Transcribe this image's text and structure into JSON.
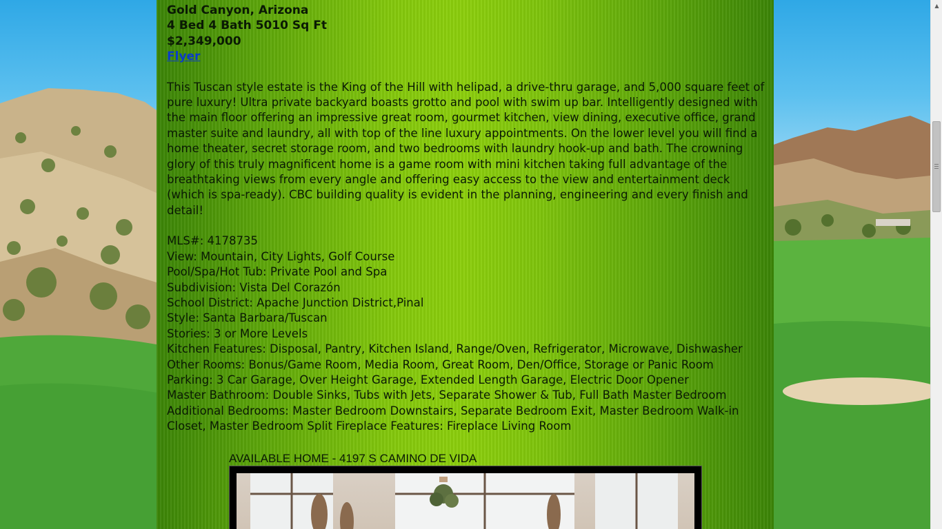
{
  "listing": {
    "location": "Gold Canyon, Arizona",
    "specs": "4 Bed 4 Bath 5010 Sq Ft",
    "price": "$2,349,000",
    "flyer_link": "Flyer",
    "description": "This Tuscan style estate is the King of the Hill with helipad, a drive-thru garage, and 5,000 square feet of pure luxury! Ultra private backyard boasts grotto and pool with swim up bar. Intelligently designed with the main floor offering an impressive great room, gourmet kitchen, view dining, executive office, grand master suite and laundry, all with top of the line luxury appointments. On the lower level you will find a home theater, secret storage room, and two bedrooms with laundry hook-up and bath. The crowning glory of this truly magnificent home is a game room with mini kitchen taking full advantage of the breathtaking views from every angle and offering easy access to the view and entertainment deck (which is spa-ready). CBC building quality is evident in the planning, engineering and every finish and detail!",
    "details": [
      "MLS#: 4178735",
      "View: Mountain, City Lights, Golf Course",
      "Pool/Spa/Hot Tub: Private Pool and Spa",
      "Subdivision: Vista Del Corazón",
      "School District: Apache Junction District,Pinal",
      "Style: Santa Barbara/Tuscan",
      "Stories: 3 or More Levels",
      "Kitchen Features: Disposal, Pantry, Kitchen Island, Range/Oven, Refrigerator, Microwave, Dishwasher",
      "Other Rooms: Bonus/Game Room, Media Room, Great Room, Den/Office, Storage or Panic Room",
      "Parking: 3 Car Garage, Over Height Garage, Extended Length Garage, Electric Door Opener",
      "Master Bathroom: Double Sinks, Tubs with Jets, Separate Shower & Tub, Full Bath Master Bedroom",
      "Additional Bedrooms: Master Bedroom Downstairs, Separate Bedroom Exit, Master Bedroom Walk-in Closet, Master Bedroom Split Fireplace Features: Fireplace Living Room"
    ]
  },
  "available_home": {
    "title": "AVAILABLE HOME - 4197 S CAMINO DE VIDA"
  },
  "colors": {
    "content_green": "#84c80c",
    "link_blue": "#0a3cc8",
    "text_dark": "#0a1a04"
  },
  "icons": {
    "scroll_up": "triangle-up-icon"
  }
}
